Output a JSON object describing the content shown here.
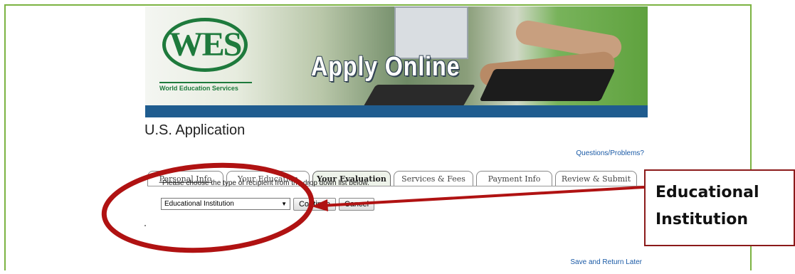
{
  "header": {
    "logo_text": "WES",
    "logo_subtext": "World Education Services",
    "banner_text": "Apply Online"
  },
  "page": {
    "title": "U.S. Application",
    "help_link": "Questions/Problems?",
    "save_link": "Save and Return Later"
  },
  "tabs": [
    {
      "label": "Personal Info"
    },
    {
      "label": "Your Education"
    },
    {
      "label": "Your Evaluation"
    },
    {
      "label": "Services & Fees"
    },
    {
      "label": "Payment Info"
    },
    {
      "label": "Review & Submit"
    }
  ],
  "form": {
    "instruction": "Please choose the type of recipient from the drop down list below.",
    "recipient_select_value": "Educational Institution",
    "continue_label": "Continue",
    "cancel_label": "Cancel"
  },
  "callout": {
    "line1": "Educational",
    "line2": "Institution"
  },
  "colors": {
    "frame_border": "#7cb342",
    "annotation_red": "#b01212",
    "link_blue": "#1a5aa6",
    "banner_strip": "#1f5c8f"
  }
}
